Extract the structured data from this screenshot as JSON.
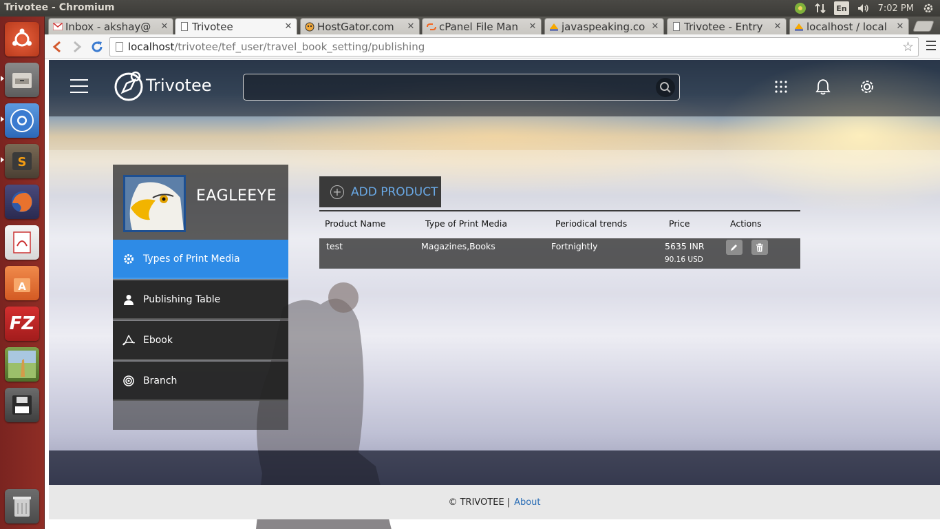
{
  "system": {
    "window_title": "Trivotee - Chromium",
    "clock": "7:02 PM",
    "keyboard_layout": "En"
  },
  "tabs": [
    {
      "label": "Inbox - akshay@",
      "icon": "gmail-icon",
      "active": false
    },
    {
      "label": "Trivotee",
      "icon": "page-icon",
      "active": true
    },
    {
      "label": "HostGator.com",
      "icon": "hostgator-icon",
      "active": false
    },
    {
      "label": "cPanel File Man",
      "icon": "cpanel-icon",
      "active": false
    },
    {
      "label": "javaspeaking.co",
      "icon": "phpmyadmin-icon",
      "active": false
    },
    {
      "label": "Trivotee - Entry",
      "icon": "page-icon",
      "active": false
    },
    {
      "label": "localhost / local",
      "icon": "phpmyadmin-icon",
      "active": false
    }
  ],
  "address_bar": {
    "host": "localhost",
    "path": "/trivotee/tef_user/travel_book_setting/publishing"
  },
  "site": {
    "logo_text": "Trivotee",
    "search_placeholder": ""
  },
  "profile": {
    "username": "EAGLEEYE"
  },
  "side_menu": [
    {
      "label": "Types of Print Media",
      "icon": "gear-icon",
      "active": true
    },
    {
      "label": "Publishing Table",
      "icon": "user-icon",
      "active": false
    },
    {
      "label": "Ebook",
      "icon": "acrobat-icon",
      "active": false
    },
    {
      "label": "Branch",
      "icon": "target-icon",
      "active": false
    }
  ],
  "products": {
    "add_button_label": "ADD PRODUCT",
    "columns": [
      "Product Name",
      "Type of Print Media",
      "Periodical trends",
      "Price",
      "Actions"
    ],
    "rows": [
      {
        "name": "test",
        "media_types": "Magazines,Books",
        "periodical": "Fortnightly",
        "price_inr": "5635 INR",
        "price_usd": "90.16 USD"
      }
    ]
  },
  "footer": {
    "copyright": "© TRIVOTEE",
    "separator": "|",
    "about_label": "About"
  },
  "colors": {
    "accent": "#2e8be6",
    "link": "#2a6db5",
    "add_button_text": "#6aa9e6"
  }
}
